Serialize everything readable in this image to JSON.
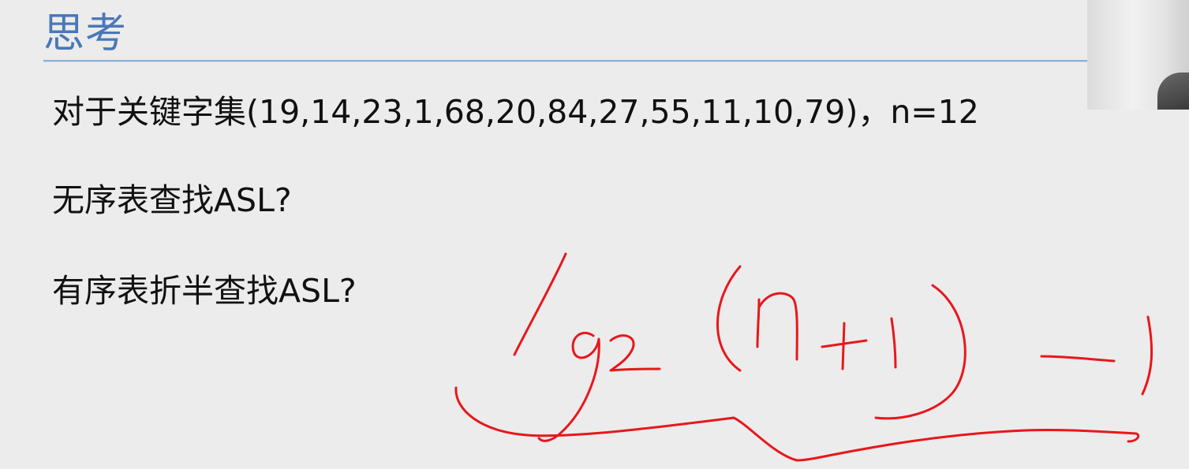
{
  "slide": {
    "title": "思考",
    "lines": [
      "对于关键字集(19,14,23,1,68,20,84,27,55,11,10,79)，n=12",
      "无序表查找ASL?",
      "有序表折半查找ASL?"
    ]
  },
  "annotation": {
    "ink_color": "#e8171c"
  }
}
